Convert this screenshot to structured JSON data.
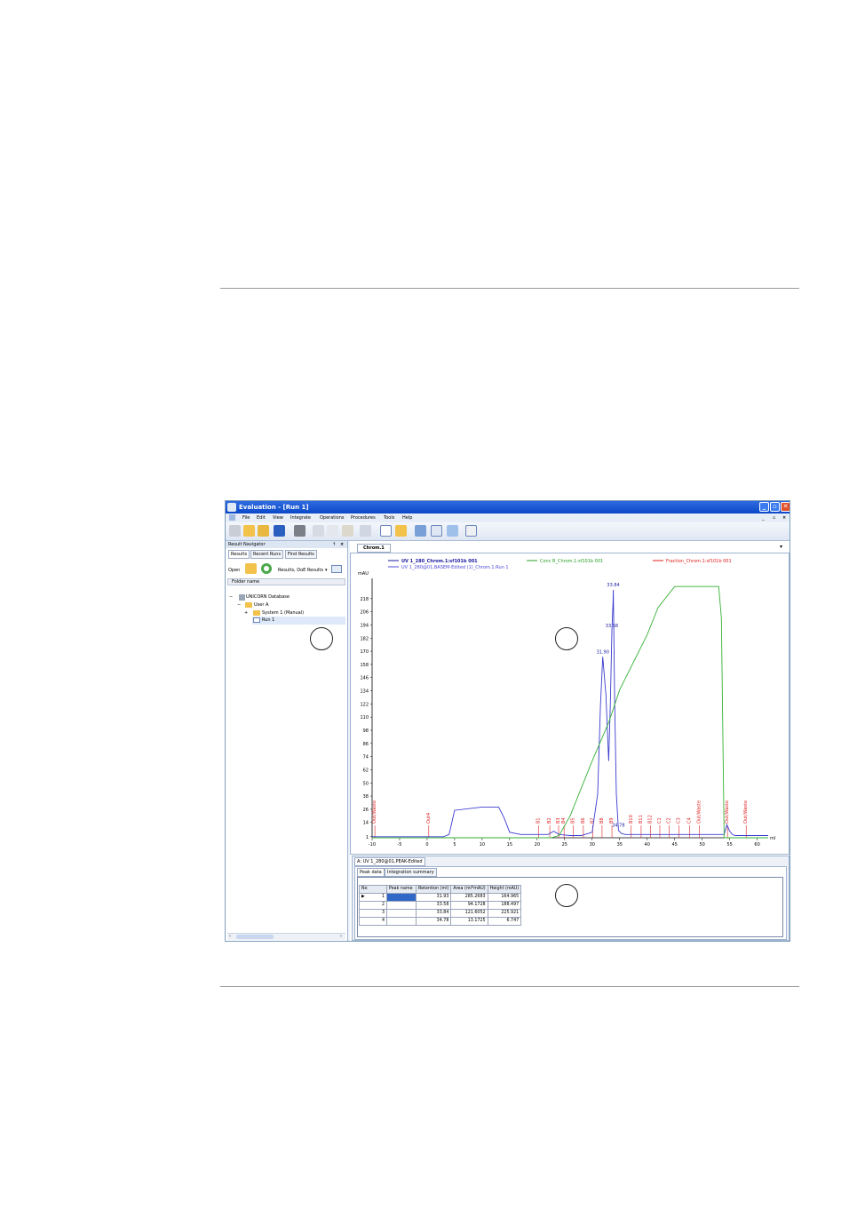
{
  "window": {
    "title": "Evaluation - [Run 1]"
  },
  "menu": [
    "File",
    "Edit",
    "View",
    "Integrate",
    "Operations",
    "Procedures",
    "Tools",
    "Help"
  ],
  "navigator": {
    "title": "Result Navigator",
    "pin": "↑",
    "tabs": [
      "Results",
      "Recent Runs",
      "Find Results"
    ],
    "open_label": "Open",
    "filter_value": "Results, DoE Results",
    "column_header": "Folder name",
    "tree": [
      {
        "label": "UNICORN Database",
        "expander": "−"
      },
      {
        "label": "User A",
        "expander": "−"
      },
      {
        "label": "System 1 (Manual)",
        "expander": "+"
      },
      {
        "label": "Run 1",
        "expander": ""
      }
    ]
  },
  "chrom_tab": "Chrom.1",
  "chart_data": {
    "type": "line",
    "ylabel": "mAU",
    "xlabel": "ml",
    "xlim": [
      -10,
      62
    ],
    "ylim": [
      0,
      230
    ],
    "x_ticks": [
      -10,
      -5,
      0,
      5,
      10,
      15,
      20,
      25,
      30,
      35,
      40,
      45,
      50,
      55,
      60
    ],
    "y_ticks": [
      1,
      14,
      26,
      38,
      50,
      62,
      74,
      86,
      98,
      110,
      122,
      134,
      146,
      158,
      170,
      182,
      194,
      206,
      218
    ],
    "legend": [
      {
        "name": "UV 1_280_Chrom.1:sf101b 001",
        "color": "#1a1aa0",
        "bold": true
      },
      {
        "name": "UV 1_280@01,BASEM-Edited (1)_Chrom.1:Run 1",
        "color": "#4b4bd8",
        "bold": false
      },
      {
        "name": "Conc B_Chrom.1:sf101b 001",
        "color": "#2aa02a",
        "bold": false
      },
      {
        "name": "Fraction_Chrom.1:sf101b 001",
        "color": "#e02020",
        "bold": false
      }
    ],
    "series": [
      {
        "name": "UV 1_280_Chrom.1:sf101b 001",
        "color": "#3b3bd0",
        "x": [
          -10,
          0,
          3,
          4,
          5,
          10,
          13,
          14,
          15,
          17,
          19,
          21,
          22,
          23,
          24,
          26,
          28,
          30,
          31,
          31.5,
          31.93,
          32.5,
          33,
          33.3,
          33.58,
          33.8,
          33.84,
          34.1,
          34.4,
          34.78,
          35.3,
          36,
          40,
          45,
          50,
          54,
          54.5,
          55,
          55.5,
          56,
          60,
          62
        ],
        "y": [
          1,
          1,
          1,
          3,
          25,
          28,
          28,
          18,
          5,
          3,
          3,
          3,
          3,
          6,
          3,
          2,
          2,
          5,
          40,
          120,
          164.965,
          130,
          70,
          120,
          188.497,
          215,
          225.921,
          120,
          40,
          6.747,
          4,
          3,
          3,
          3,
          3,
          3,
          12,
          6,
          3,
          2,
          2,
          2
        ]
      },
      {
        "name": "Conc B_Chrom.1:sf101b 001",
        "color": "#35b035",
        "x": [
          -10,
          22.5,
          24,
          26,
          28,
          30,
          33,
          35,
          40,
          42,
          45,
          48,
          50,
          52,
          53,
          53.5,
          54,
          62
        ],
        "y": [
          0,
          0,
          2,
          20,
          45,
          70,
          105,
          135,
          185,
          210,
          229,
          229,
          229,
          229,
          229,
          200,
          0,
          0
        ]
      }
    ],
    "peak_labels": [
      {
        "x": 31.93,
        "y": 164.965,
        "text": "31.90"
      },
      {
        "x": 33.58,
        "y": 188.497,
        "text": "33.58"
      },
      {
        "x": 33.84,
        "y": 225.921,
        "text": "33.84"
      },
      {
        "x": 34.78,
        "y": 6.747,
        "text": "34.78"
      }
    ],
    "fraction_marks": [
      {
        "x": -9.5,
        "label": "Out/Waste"
      },
      {
        "x": 0.3,
        "label": "Out4"
      },
      {
        "x": 20.3,
        "label": "B1"
      },
      {
        "x": 22.3,
        "label": "B2"
      },
      {
        "x": 23.9,
        "label": "B3"
      },
      {
        "x": 24.9,
        "label": "B4"
      },
      {
        "x": 26.6,
        "label": "B5"
      },
      {
        "x": 28.4,
        "label": "B6"
      },
      {
        "x": 30.1,
        "label": "B7"
      },
      {
        "x": 31.8,
        "label": "B8"
      },
      {
        "x": 33.6,
        "label": "B9"
      },
      {
        "x": 37.1,
        "label": "B10"
      },
      {
        "x": 38.9,
        "label": "B11"
      },
      {
        "x": 40.6,
        "label": "B12"
      },
      {
        "x": 42.3,
        "label": "C1"
      },
      {
        "x": 44.0,
        "label": "C2"
      },
      {
        "x": 45.8,
        "label": "C3"
      },
      {
        "x": 47.7,
        "label": "C4"
      },
      {
        "x": 49.5,
        "label": "Out/Waste"
      },
      {
        "x": 54.6,
        "label": "Out/Waste"
      },
      {
        "x": 58.0,
        "label": "Out/Waste"
      }
    ]
  },
  "peak_panel": {
    "tab": "A: UV 1_280@01,PEAK-Edited",
    "subtabs": [
      "Peak data",
      "Integration summary"
    ],
    "columns": [
      "No",
      "Peak name",
      "Retention (ml)",
      "Area (ml*mAU)",
      "Height (mAU)"
    ],
    "rows": [
      {
        "no": "1",
        "name": "",
        "retention": "31.93",
        "area": "285.2683",
        "height": "164.965"
      },
      {
        "no": "2",
        "name": "",
        "retention": "33.58",
        "area": "94.1728",
        "height": "188.497"
      },
      {
        "no": "3",
        "name": "",
        "retention": "33.84",
        "area": "121.6052",
        "height": "225.921"
      },
      {
        "no": "4",
        "name": "",
        "retention": "34.78",
        "area": "13.1725",
        "height": "6.747"
      }
    ]
  },
  "colors": {
    "accent": "#0a48c8",
    "selection": "#3168c8"
  }
}
